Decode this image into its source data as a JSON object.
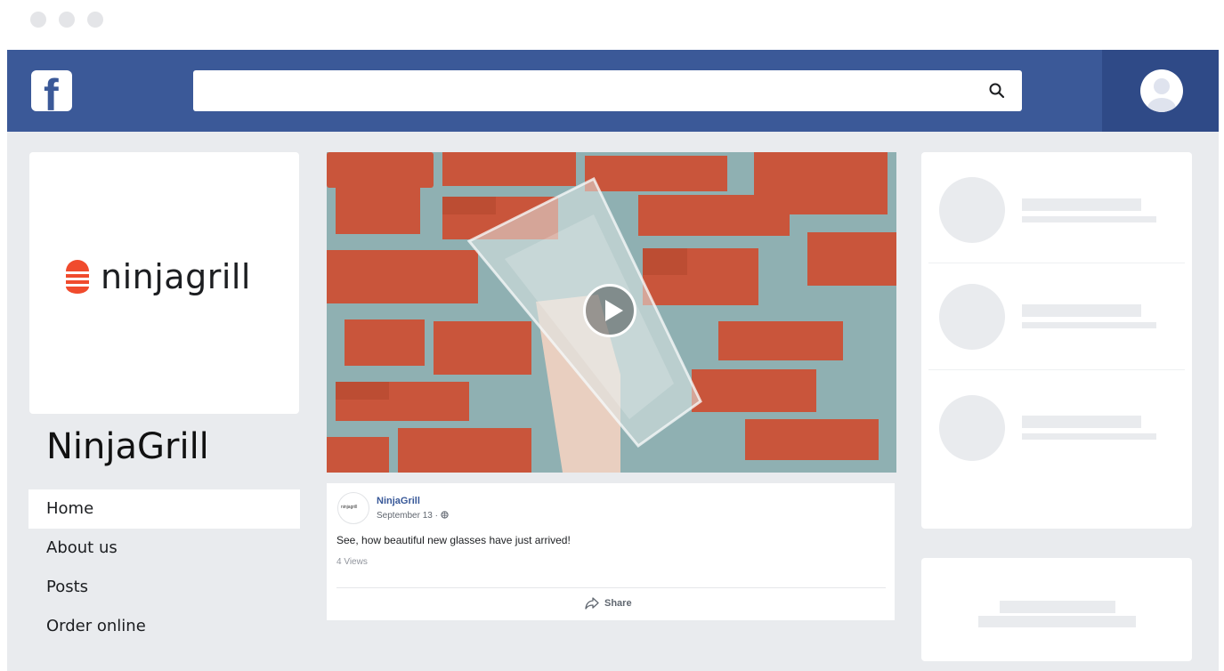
{
  "browser": {
    "dot_color": "#e4e5e8"
  },
  "topbar": {
    "color": "#3b5998",
    "logo_icon": "facebook-f-icon",
    "logo_letter": "f",
    "search": {
      "value": "",
      "placeholder": "",
      "icon": "search-icon"
    },
    "profile_icon": "user-avatar-icon"
  },
  "left": {
    "logo_text": "ninjagrill",
    "logo_color": "#f04b2d",
    "page_name": "NinjaGrill",
    "nav": [
      {
        "label": "Home",
        "active": true
      },
      {
        "label": "About us",
        "active": false
      },
      {
        "label": "Posts",
        "active": false
      },
      {
        "label": "Order online",
        "active": false
      }
    ]
  },
  "post": {
    "play_icon": "play-icon",
    "author": "NinjaGrill",
    "avatar_text": "ninjagrill",
    "date": "September 13 · ",
    "privacy_icon": "globe-icon",
    "text": "See, how beautiful new glasses have just arrived!",
    "views": "4 Views",
    "share_label": "Share",
    "share_icon": "share-arrow-icon"
  }
}
